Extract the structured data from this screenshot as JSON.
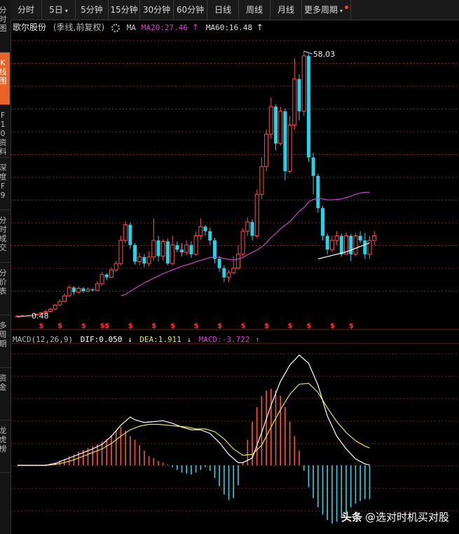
{
  "toolbar": {
    "items": [
      {
        "label": "分时"
      },
      {
        "label": "5日",
        "caret": "▾"
      },
      {
        "label": "5分钟"
      },
      {
        "label": "15分钟"
      },
      {
        "label": "30分钟"
      },
      {
        "label": "60分钟"
      },
      {
        "label": "日线"
      },
      {
        "label": "周线"
      },
      {
        "label": "月线"
      },
      {
        "label": "更多周期",
        "caret": "▾"
      }
    ]
  },
  "sidebar": {
    "items": [
      {
        "label": "分时图"
      },
      {
        "label": "K线图",
        "active": true
      },
      {
        "label": "F10资料"
      },
      {
        "label": "深度F9"
      },
      {
        "label": "分时成交"
      },
      {
        "label": "分价表"
      },
      {
        "label": "多周期"
      },
      {
        "label": "资金"
      },
      {
        "label": "龙虎榜"
      }
    ]
  },
  "info": {
    "stock_name": "歌尔股份",
    "period_label": "(季线,前复权)",
    "ma_label": "MA",
    "ma20": "MA20:27.46",
    "ma20_arrow": "↑",
    "ma60": "MA60:16.48",
    "ma60_arrow": "↑"
  },
  "macd_info": {
    "label": "MACD(12,26,9)",
    "dif": "DIF:0.050",
    "dif_arrow": "↓",
    "dea": "DEA:1.911",
    "dea_arrow": "↓",
    "macd": "MACD:-3.722",
    "macd_arrow": "↑"
  },
  "colors": {
    "up": "#ff4d4d",
    "down": "#29d0e6",
    "ma20": "#d040d0",
    "ma60": "#ffffff",
    "dif": "#ffffff",
    "dea": "#e8e830",
    "grid": "#8a1f1f",
    "marker": "#ff3030"
  },
  "chart_data": {
    "type": "candlestick",
    "price_ylim": [
      0,
      60
    ],
    "macd_ylim": [
      -7,
      13
    ],
    "annotations": {
      "high": "58.03",
      "low": "0.48"
    },
    "marker_glyph": "$",
    "candles": [
      [
        0.5,
        0.6,
        0.4,
        0.8
      ],
      [
        0.6,
        0.7,
        0.5,
        0.9
      ],
      [
        0.7,
        0.6,
        0.45,
        0.8
      ],
      [
        0.6,
        0.8,
        0.5,
        0.9
      ],
      [
        0.8,
        1.0,
        0.7,
        1.2
      ],
      [
        1.0,
        1.3,
        0.9,
        1.5
      ],
      [
        1.3,
        1.6,
        1.1,
        1.9
      ],
      [
        1.6,
        2.1,
        1.5,
        2.4
      ],
      [
        2.1,
        3.0,
        1.9,
        3.2
      ],
      [
        3.0,
        3.8,
        2.8,
        4.2
      ],
      [
        3.8,
        5.0,
        3.6,
        5.5
      ],
      [
        5.0,
        6.8,
        4.8,
        7.3
      ],
      [
        6.8,
        5.8,
        5.2,
        7.1
      ],
      [
        5.8,
        6.6,
        5.4,
        7.0
      ],
      [
        6.6,
        6.0,
        5.6,
        6.9
      ],
      [
        6.0,
        6.4,
        5.8,
        6.8
      ],
      [
        6.4,
        6.2,
        5.9,
        6.6
      ],
      [
        6.2,
        7.6,
        5.9,
        8.2
      ],
      [
        7.6,
        9.6,
        7.2,
        10.2
      ],
      [
        9.6,
        9.0,
        8.4,
        9.9
      ],
      [
        9.0,
        10.6,
        8.8,
        11.2
      ],
      [
        10.6,
        12.0,
        10.2,
        12.6
      ],
      [
        12.0,
        17.0,
        11.6,
        18.0
      ],
      [
        17.0,
        20.4,
        16.4,
        21.2
      ],
      [
        20.4,
        16.0,
        15.2,
        20.9
      ],
      [
        16.0,
        12.4,
        11.8,
        16.4
      ],
      [
        12.4,
        13.4,
        11.6,
        14.3
      ],
      [
        13.4,
        12.0,
        11.2,
        14.0
      ],
      [
        12.0,
        13.4,
        11.4,
        14.6
      ],
      [
        13.4,
        17.0,
        12.6,
        21.8
      ],
      [
        17.0,
        13.6,
        12.4,
        18.0
      ],
      [
        13.6,
        16.8,
        12.6,
        17.2
      ],
      [
        16.8,
        12.0,
        11.6,
        17.4
      ],
      [
        12.0,
        16.0,
        11.6,
        18.0
      ],
      [
        16.0,
        15.0,
        14.4,
        16.8
      ],
      [
        15.0,
        14.4,
        13.6,
        16.4
      ],
      [
        14.4,
        16.0,
        13.8,
        17.0
      ],
      [
        16.0,
        14.0,
        13.2,
        16.8
      ],
      [
        14.0,
        18.0,
        13.6,
        19.0
      ],
      [
        18.0,
        20.0,
        17.2,
        21.8
      ],
      [
        20.0,
        19.0,
        18.0,
        20.4
      ],
      [
        19.0,
        17.0,
        16.0,
        19.8
      ],
      [
        17.0,
        13.0,
        12.0,
        17.6
      ],
      [
        13.0,
        11.0,
        10.2,
        13.6
      ],
      [
        11.0,
        9.0,
        8.0,
        11.6
      ],
      [
        9.0,
        10.0,
        8.0,
        10.6
      ],
      [
        10.0,
        11.0,
        9.6,
        13.6
      ],
      [
        11.0,
        14.0,
        10.6,
        16.0
      ],
      [
        14.0,
        19.0,
        13.6,
        19.6
      ],
      [
        19.0,
        21.0,
        18.0,
        22.0
      ],
      [
        21.0,
        18.0,
        17.0,
        21.6
      ],
      [
        18.0,
        27.0,
        17.6,
        28.0
      ],
      [
        27.0,
        33.0,
        26.0,
        35.0
      ],
      [
        33.0,
        40.0,
        32.0,
        41.0
      ],
      [
        40.0,
        46.0,
        39.0,
        48.0
      ],
      [
        46.0,
        38.0,
        36.5,
        46.5
      ],
      [
        38.0,
        45.0,
        37.5,
        46.0
      ],
      [
        45.0,
        32.0,
        30.0,
        45.6
      ],
      [
        32.0,
        42.0,
        31.6,
        44.0
      ],
      [
        42.0,
        52.0,
        41.0,
        56.5
      ],
      [
        52.0,
        45.0,
        43.0,
        53.0
      ],
      [
        45.0,
        57.0,
        44.0,
        58.03
      ],
      [
        57.0,
        35.0,
        34.0,
        57.5
      ],
      [
        35.0,
        31.0,
        27.0,
        36.0
      ],
      [
        31.0,
        24.0,
        23.0,
        31.5
      ],
      [
        24.0,
        18.0,
        17.0,
        24.5
      ],
      [
        18.0,
        15.0,
        14.0,
        18.5
      ],
      [
        15.0,
        17.0,
        14.5,
        18.0
      ],
      [
        17.0,
        18.0,
        16.0,
        19.0
      ],
      [
        18.0,
        14.0,
        13.5,
        18.5
      ],
      [
        14.0,
        18.0,
        13.8,
        18.8
      ],
      [
        18.0,
        14.0,
        12.5,
        18.4
      ],
      [
        14.0,
        18.0,
        13.6,
        18.6
      ],
      [
        18.0,
        17.0,
        16.4,
        19.0
      ],
      [
        17.0,
        14.0,
        13.0,
        18.6
      ],
      [
        14.0,
        17.0,
        13.0,
        18.0
      ],
      [
        17.0,
        18.0,
        16.0,
        19.0
      ]
    ],
    "ma20": [
      [
        22,
        5.0
      ],
      [
        23,
        5.3
      ],
      [
        24,
        6.0
      ],
      [
        25,
        6.6
      ],
      [
        26,
        7.2
      ],
      [
        27,
        7.8
      ],
      [
        28,
        8.3
      ],
      [
        29,
        8.8
      ],
      [
        30,
        9.3
      ],
      [
        31,
        9.8
      ],
      [
        32,
        10.2
      ],
      [
        33,
        10.6
      ],
      [
        34,
        11.0
      ],
      [
        35,
        11.4
      ],
      [
        36,
        11.7
      ],
      [
        37,
        12.0
      ],
      [
        38,
        12.4
      ],
      [
        39,
        12.7
      ],
      [
        40,
        13.0
      ],
      [
        41,
        13.3
      ],
      [
        42,
        13.4
      ],
      [
        43,
        13.3
      ],
      [
        44,
        13.1
      ],
      [
        45,
        12.9
      ],
      [
        46,
        12.8
      ],
      [
        47,
        13.0
      ],
      [
        48,
        13.3
      ],
      [
        49,
        13.9
      ],
      [
        50,
        14.4
      ],
      [
        51,
        14.9
      ],
      [
        52,
        15.6
      ],
      [
        53,
        16.5
      ],
      [
        54,
        17.6
      ],
      [
        55,
        18.5
      ],
      [
        56,
        19.5
      ],
      [
        57,
        20.3
      ],
      [
        58,
        21.1
      ],
      [
        59,
        22.2
      ],
      [
        60,
        23.3
      ],
      [
        61,
        24.1
      ],
      [
        62,
        25.3
      ],
      [
        63,
        25.9
      ],
      [
        64,
        26.1
      ],
      [
        65,
        26.0
      ],
      [
        66,
        25.8
      ],
      [
        67,
        25.8
      ],
      [
        68,
        25.9
      ],
      [
        69,
        26.0
      ],
      [
        70,
        26.3
      ],
      [
        71,
        26.6
      ],
      [
        72,
        27.0
      ],
      [
        73,
        27.3
      ],
      [
        74,
        27.4
      ],
      [
        75,
        27.46
      ]
    ],
    "ma60": [
      [
        64,
        13.0
      ],
      [
        70,
        14.5
      ],
      [
        75,
        16.48
      ]
    ],
    "dif": [
      [
        0,
        0.0
      ],
      [
        2,
        0.0
      ],
      [
        4,
        0.0
      ],
      [
        6,
        0.0
      ],
      [
        8,
        0.2
      ],
      [
        10,
        0.6
      ],
      [
        12,
        1.0
      ],
      [
        14,
        1.4
      ],
      [
        16,
        1.8
      ],
      [
        18,
        2.3
      ],
      [
        20,
        3.2
      ],
      [
        22,
        4.4
      ],
      [
        24,
        5.3
      ],
      [
        25,
        5.0
      ],
      [
        27,
        4.7
      ],
      [
        29,
        4.8
      ],
      [
        31,
        4.9
      ],
      [
        33,
        4.6
      ],
      [
        35,
        4.2
      ],
      [
        37,
        3.9
      ],
      [
        39,
        3.9
      ],
      [
        41,
        3.5
      ],
      [
        43,
        2.5
      ],
      [
        45,
        1.2
      ],
      [
        47,
        0.3
      ],
      [
        48,
        0.3
      ],
      [
        50,
        0.8
      ],
      [
        52,
        3.6
      ],
      [
        54,
        6.6
      ],
      [
        56,
        9.2
      ],
      [
        58,
        11.0
      ],
      [
        60,
        12.1
      ],
      [
        62,
        11.2
      ],
      [
        64,
        8.8
      ],
      [
        66,
        5.4
      ],
      [
        68,
        3.2
      ],
      [
        70,
        1.8
      ],
      [
        72,
        0.7
      ],
      [
        74,
        0.15
      ],
      [
        75,
        0.05
      ]
    ],
    "dea": [
      [
        0,
        0.0
      ],
      [
        6,
        0.0
      ],
      [
        8,
        0.1
      ],
      [
        10,
        0.3
      ],
      [
        12,
        0.6
      ],
      [
        14,
        1.0
      ],
      [
        16,
        1.4
      ],
      [
        18,
        1.8
      ],
      [
        20,
        2.4
      ],
      [
        22,
        3.2
      ],
      [
        24,
        3.9
      ],
      [
        26,
        4.3
      ],
      [
        28,
        4.5
      ],
      [
        30,
        4.5
      ],
      [
        32,
        4.4
      ],
      [
        34,
        4.3
      ],
      [
        36,
        4.2
      ],
      [
        38,
        4.0
      ],
      [
        40,
        4.0
      ],
      [
        42,
        3.7
      ],
      [
        44,
        2.9
      ],
      [
        46,
        1.8
      ],
      [
        48,
        1.1
      ],
      [
        50,
        1.2
      ],
      [
        52,
        2.2
      ],
      [
        54,
        4.2
      ],
      [
        56,
        6.1
      ],
      [
        58,
        7.8
      ],
      [
        60,
        8.9
      ],
      [
        62,
        9.0
      ],
      [
        64,
        8.0
      ],
      [
        66,
        6.3
      ],
      [
        68,
        4.8
      ],
      [
        70,
        3.6
      ],
      [
        72,
        2.7
      ],
      [
        74,
        2.1
      ],
      [
        75,
        1.911
      ]
    ],
    "macd_hist": [
      0,
      0,
      0,
      0,
      0,
      0,
      0.1,
      0.2,
      0.3,
      0.5,
      0.7,
      1.0,
      1.2,
      1.5,
      1.7,
      1.9,
      2.1,
      2.3,
      2.6,
      2.9,
      3.3,
      3.8,
      4.2,
      3.8,
      3.2,
      2.8,
      2.2,
      1.6,
      1.0,
      0.8,
      0.5,
      0.3,
      0.1,
      -0.2,
      -0.5,
      -0.8,
      -0.9,
      -1.0,
      -0.8,
      -0.5,
      -0.2,
      -0.6,
      -1.4,
      -2.3,
      -3.2,
      -3.8,
      -3.6,
      -2.2,
      0.3,
      2.8,
      4.8,
      6.4,
      7.6,
      8.2,
      8.4,
      8.2,
      7.6,
      6.4,
      4.8,
      3.2,
      1.6,
      -0.6,
      -2.4,
      -3.6,
      -4.6,
      -5.4,
      -6.0,
      -6.4,
      -6.2,
      -5.8,
      -5.2,
      -4.6,
      -4.2,
      -3.9,
      -3.722,
      -3.722
    ]
  }
}
